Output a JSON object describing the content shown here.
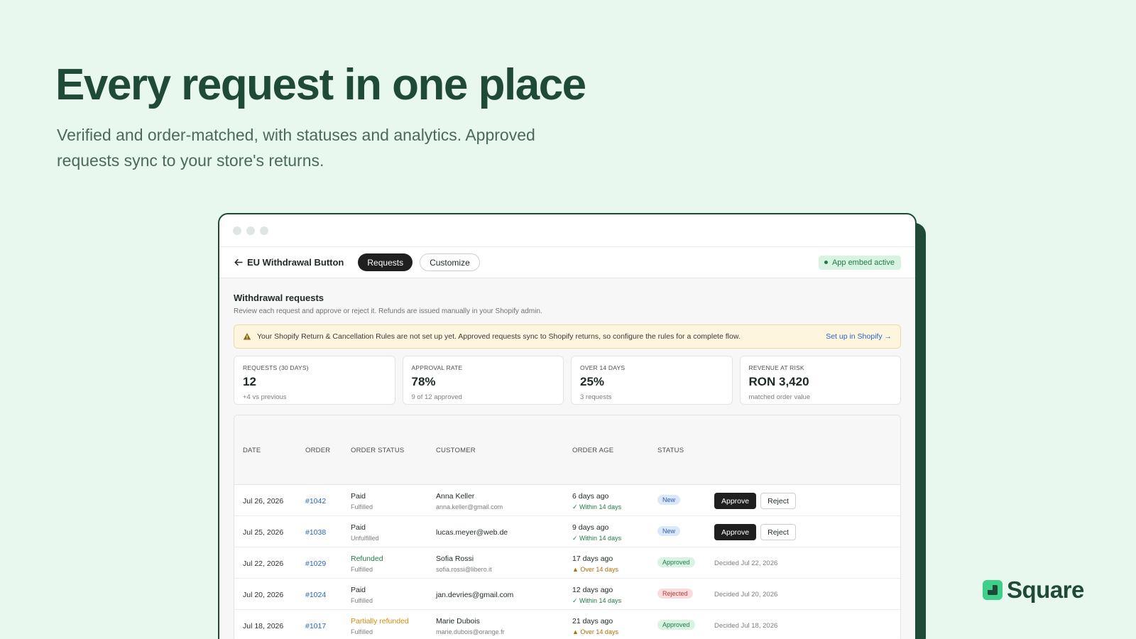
{
  "hero": {
    "title": "Every request in one place",
    "subtitle": "Verified and order-matched, with statuses and analytics. Approved requests sync to your store's returns."
  },
  "app": {
    "title": "EU Withdrawal Button",
    "tabs": [
      {
        "label": "Requests",
        "active": true
      },
      {
        "label": "Customize",
        "active": false
      }
    ],
    "embed_badge": "App embed active"
  },
  "page": {
    "title": "Withdrawal requests",
    "description": "Review each request and approve or reject it. Refunds are issued manually in your Shopify admin."
  },
  "alert": {
    "message": "Your Shopify Return & Cancellation Rules are not set up yet. Approved requests sync to Shopify returns, so configure the rules for a complete flow.",
    "link": "Set up in Shopify →"
  },
  "stats": [
    {
      "label": "REQUESTS (30 DAYS)",
      "value": "12",
      "note": "+4 vs previous"
    },
    {
      "label": "APPROVAL RATE",
      "value": "78%",
      "note": "9 of 12 approved"
    },
    {
      "label": "OVER 14 DAYS",
      "value": "25%",
      "note": "3 requests"
    },
    {
      "label": "REVENUE AT RISK",
      "value": "RON 3,420",
      "note": "matched order value"
    }
  ],
  "table": {
    "headers": {
      "date": "DATE",
      "order": "ORDER",
      "order_status": "ORDER STATUS",
      "customer": "CUSTOMER",
      "order_age": "ORDER AGE",
      "status": "STATUS"
    },
    "rows": [
      {
        "date": "Jul 26, 2026",
        "order": "#1042",
        "payment": "Paid",
        "fulfillment": "Fulfilled",
        "name": "Anna Keller",
        "email": "anna.keller@gmail.com",
        "age": "6 days ago",
        "window": "✓ Within 14 days",
        "status": "New",
        "approve": "Approve",
        "reject": "Reject"
      },
      {
        "date": "Jul 25, 2026",
        "order": "#1038",
        "payment": "Paid",
        "fulfillment": "Unfulfilled",
        "email": "lucas.meyer@web.de",
        "age": "9 days ago",
        "window": "✓ Within 14 days",
        "status": "New",
        "approve": "Approve",
        "reject": "Reject"
      },
      {
        "date": "Jul 22, 2026",
        "order": "#1029",
        "payment": "Refunded",
        "fulfillment": "Fulfilled",
        "name": "Sofia Rossi",
        "email": "sofia.rossi@libero.it",
        "age": "17 days ago",
        "window": "Over 14 days",
        "status": "Approved",
        "decided": "Decided Jul 22, 2026"
      },
      {
        "date": "Jul 20, 2026",
        "order": "#1024",
        "payment": "Paid",
        "fulfillment": "Fulfilled",
        "email": "jan.devries@gmail.com",
        "age": "12 days ago",
        "window": "✓ Within 14 days",
        "status": "Rejected",
        "decided": "Decided Jul 20, 2026"
      },
      {
        "date": "Jul 18, 2026",
        "order": "#1017",
        "payment": "Partially refunded",
        "fulfillment": "Fulfilled",
        "name": "Marie Dubois",
        "email": "marie.dubois@orange.fr",
        "age": "21 days ago",
        "window": "Over 14 days",
        "status": "Approved",
        "decided": "Decided Jul 18, 2026"
      }
    ]
  },
  "brand": {
    "name": "Square",
    "color": "#3ed08a"
  },
  "colors": {
    "background": "#e8f8ee",
    "accent_dark": "#1e4a37"
  }
}
